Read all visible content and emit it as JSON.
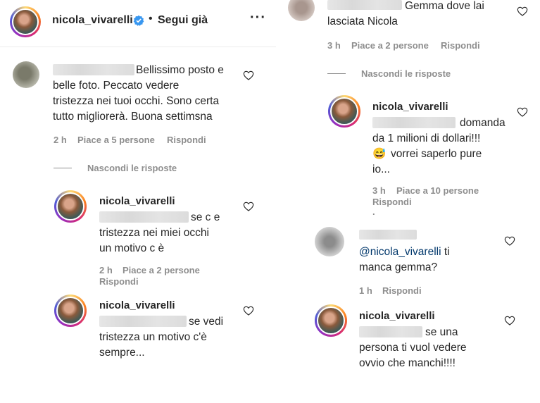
{
  "post_header": {
    "username": "nicola_vivarelli",
    "follow_status": "Segui già",
    "more_icon": "more-horizontal-icon"
  },
  "left": {
    "comment_1": {
      "text_lines": [
        "Bellissimo posto e",
        "belle foto. Peccato vedere",
        "tristezza nei tuoi occhi. Sono certa",
        "tutto migliorerà. Buona settimsna"
      ],
      "time": "2 h",
      "likes": "Piace a 5 persone",
      "reply": "Rispondi"
    },
    "hide_replies": "Nascondi le risposte",
    "reply_1": {
      "username": "nicola_vivarelli",
      "text_lines": [
        "se c e",
        "tristezza nei miei occhi",
        "un motivo c è"
      ],
      "time": "2 h",
      "likes": "Piace a 2 persone",
      "reply": "Rispondi"
    },
    "reply_2": {
      "username": "nicola_vivarelli",
      "text_lines": [
        "se vedi",
        "tristezza un motivo c'è",
        "sempre..."
      ]
    }
  },
  "right": {
    "comment_top": {
      "text_lines": [
        "Gemma dove lai",
        "lasciata Nicola"
      ],
      "time": "3 h",
      "likes": "Piace a 2 persone",
      "reply": "Rispondi"
    },
    "hide_replies": "Nascondi le risposte",
    "reply_a": {
      "username": "nicola_vivarelli",
      "text_lines": [
        "domanda",
        "da 1 milioni di dollari!!!",
        "vorrei saperlo pure",
        "io..."
      ],
      "emoji": "😅",
      "time": "3 h",
      "likes": "Piace a 10 persone",
      "reply": "Rispondi",
      "dot": "."
    },
    "comment_b": {
      "mention": "@nicola_vivarelli",
      "text_after": " ti",
      "text_line2": "manca gemma?",
      "time": "1 h",
      "reply": "Rispondi"
    },
    "reply_c": {
      "username": "nicola_vivarelli",
      "text_lines": [
        "se una",
        "persona ti vuol vedere",
        "ovvio che manchi!!!!"
      ]
    }
  },
  "colors": {
    "verified": "#3897f0",
    "text": "#262626",
    "meta": "#8e8e8e",
    "mention": "#00376b"
  }
}
